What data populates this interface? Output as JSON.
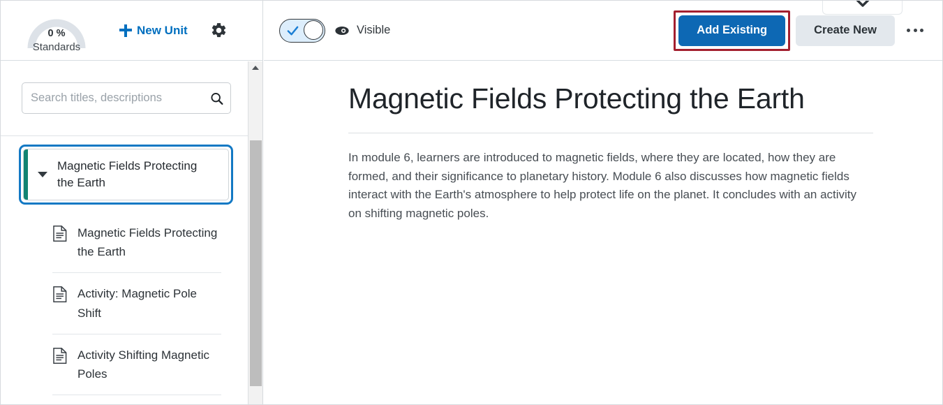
{
  "left_panel": {
    "gauge": {
      "percent_label": "0 %",
      "caption": "Standards",
      "value": 0,
      "track_color": "#dde2e8"
    },
    "new_unit_label": "New Unit",
    "settings_icon": "gear-icon",
    "search": {
      "placeholder": "Search titles, descriptions",
      "value": "",
      "icon": "search-icon"
    },
    "unit": {
      "title": "Magnetic Fields Protecting the Earth",
      "expanded": true,
      "selected": true,
      "accent_color": "#128472",
      "focus_ring_color": "#1379c4",
      "caret_icon": "caret-down-icon"
    },
    "children": [
      {
        "label": "Magnetic Fields Protecting the Earth",
        "icon": "document-icon"
      },
      {
        "label": "Activity: Magnetic Pole Shift",
        "icon": "document-icon"
      },
      {
        "label": "Activity Shifting Magnetic Poles",
        "icon": "document-icon"
      }
    ],
    "scrollbar": {
      "up_arrow_icon": "caret-up-icon"
    }
  },
  "toolbar": {
    "toggle": {
      "state": "on",
      "check_icon": "check-icon",
      "track_color": "#ddeefc"
    },
    "eye_icon": "eye-icon",
    "visible_label": "Visible",
    "clipped_dropdown_icon": "chevron-down-icon",
    "add_existing_label": "Add Existing",
    "add_existing_color": "#0d68b4",
    "highlight_color": "#a31f2f",
    "create_new_label": "Create New",
    "create_new_color": "#e3e8ed",
    "more_options_icon": "ellipsis-icon"
  },
  "content": {
    "title": "Magnetic Fields Protecting the Earth",
    "body": "In module 6, learners are introduced to magnetic fields, where they are located, how they are formed, and their significance to planetary history. Module 6 also discusses how magnetic fields interact with the Earth's atmosphere to help protect life on the planet. It concludes with an activity on shifting magnetic poles."
  }
}
